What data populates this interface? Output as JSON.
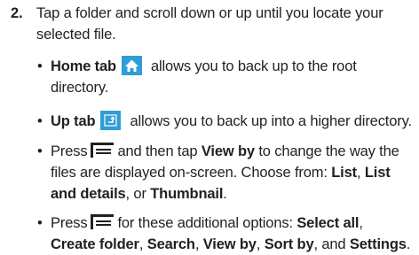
{
  "step": {
    "number": "2.",
    "text_line1": "Tap a folder and scroll down or up until you locate your",
    "text_line2": "selected file."
  },
  "bullets": {
    "home": {
      "label": "Home tab",
      "text": "allows you to back up to the root directory.",
      "icon": "home-icon"
    },
    "up": {
      "label": "Up tab",
      "text": "allows you to back up into a higher directory.",
      "icon": "up-arrow-icon"
    },
    "viewby": {
      "press": "Press",
      "mid": "and then tap",
      "bold_viewby": "View by",
      "rest": "to change the way the files are displayed on-screen. Choose from:",
      "list": "List",
      "list_and_details": "List and details",
      "or": "or",
      "thumbnail": "Thumbnail",
      "icon": "menu-icon"
    },
    "options": {
      "press": "Press",
      "text": "for these additional options:",
      "select_all": "Select all",
      "create_folder": "Create folder",
      "search": "Search",
      "view_by": "View by",
      "sort_by": "Sort by",
      "and": "and",
      "settings": "Settings",
      "icon": "menu-icon"
    }
  },
  "colors": {
    "icon_tile": "#2f9ed6",
    "text": "#231f20"
  }
}
